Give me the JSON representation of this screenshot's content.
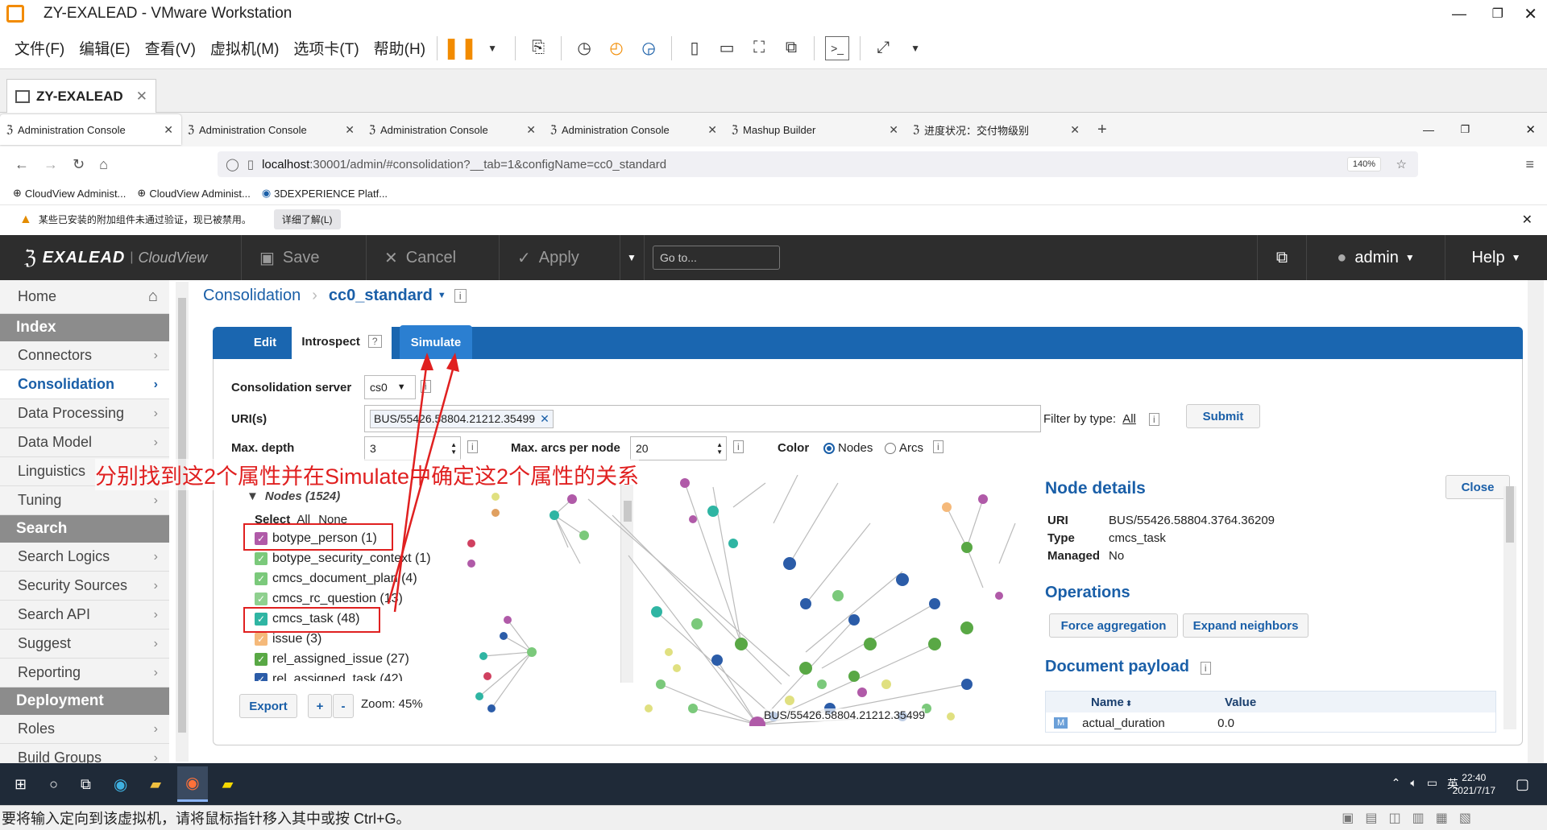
{
  "vm": {
    "title": "ZY-EXALEAD - VMware Workstation",
    "menu": [
      "文件(F)",
      "编辑(E)",
      "查看(V)",
      "虚拟机(M)",
      "选项卡(T)",
      "帮助(H)"
    ],
    "tab_label": "ZY-EXALEAD",
    "status": "要将输入定向到该虚拟机，请将鼠标指针移入其中或按 Ctrl+G。"
  },
  "browser": {
    "tabs": [
      "Administration Console",
      "Administration Console",
      "Administration Console",
      "Administration Console",
      "Mashup Builder",
      "进度状况：交付物级别"
    ],
    "url_host": "localhost",
    "url_rest": ":30001/admin/#consolidation?__tab=1&configName=cc0_standard",
    "zoom": "140%",
    "bookmarks": [
      "CloudView Administ...",
      "CloudView Administ...",
      "3DEXPERIENCE Platf..."
    ],
    "warning": "某些已安装的附加组件未通过验证，现已被禁用。",
    "warning_button": "详细了解(L)"
  },
  "app": {
    "logo": "EXALEAD",
    "logo_sub": "CloudView",
    "save": "Save",
    "cancel": "Cancel",
    "apply": "Apply",
    "goto_placeholder": "Go to...",
    "user": "admin",
    "help": "Help"
  },
  "sidebar": {
    "home": "Home",
    "sections": [
      {
        "title": "Index",
        "items": [
          "Connectors",
          "Consolidation",
          "Data Processing",
          "Data Model",
          "Linguistics",
          "Tuning"
        ]
      },
      {
        "title": "Search",
        "items": [
          "Search Logics",
          "Security Sources",
          "Search API",
          "Suggest",
          "Reporting"
        ]
      },
      {
        "title": "Deployment",
        "items": [
          "Roles",
          "Build Groups"
        ]
      }
    ]
  },
  "breadcrumb": {
    "root": "Consolidation",
    "current": "cc0_standard"
  },
  "tabs": {
    "edit": "Edit",
    "introspect": "Introspect",
    "simulate": "Simulate",
    "help_mark": "?"
  },
  "form": {
    "server_label": "Consolidation server",
    "server_value": "cs0",
    "uri_label": "URI(s)",
    "uri_value": "BUS/55426.58804.21212.35499",
    "filter_label": "Filter by type:",
    "filter_value": "All",
    "submit": "Submit",
    "depth_label": "Max. depth",
    "depth_value": "3",
    "arcs_label": "Max. arcs per node",
    "arcs_value": "20",
    "color_label": "Color",
    "color_nodes": "Nodes",
    "color_arcs": "Arcs"
  },
  "annotation": "分别找到这2个属性并在Simulate中确定这2个属性的关系",
  "nodes": {
    "header": "Nodes (1524)",
    "select_label": "Select",
    "all": "All",
    "none": "None",
    "items": [
      {
        "label": "botype_person (1)",
        "color": "#b05aa8"
      },
      {
        "label": "botype_security_context (1)",
        "color": "#7bc97b"
      },
      {
        "label": "cmcs_document_plan (4)",
        "color": "#7bc97b"
      },
      {
        "label": "cmcs_rc_question (13)",
        "color": "#8fd08f"
      },
      {
        "label": "cmcs_task (48)",
        "color": "#2fb5a3"
      },
      {
        "label": "issue (3)",
        "color": "#f5b97a"
      },
      {
        "label": "rel_assigned_issue (27)",
        "color": "#59a845"
      },
      {
        "label": "rel_assigned_task (42)",
        "color": "#2b5ca8"
      }
    ],
    "export": "Export",
    "zoom_label": "Zoom: 45%",
    "graph_label": "BUS/55426.58804.21212.35499"
  },
  "details": {
    "title": "Node details",
    "close": "Close",
    "uri_label": "URI",
    "uri": "BUS/55426.58804.3764.36209",
    "type_label": "Type",
    "type": "cmcs_task",
    "managed_label": "Managed",
    "managed": "No",
    "operations": "Operations",
    "force_aggregation": "Force aggregation",
    "expand_neighbors": "Expand neighbors",
    "payload": "Document payload",
    "col_name": "Name",
    "col_value": "Value",
    "row_tag": "M",
    "row_name": "actual_duration",
    "row_value": "0.0"
  },
  "taskbar": {
    "lang": "英",
    "time": "22:40",
    "date": "2021/7/17"
  }
}
